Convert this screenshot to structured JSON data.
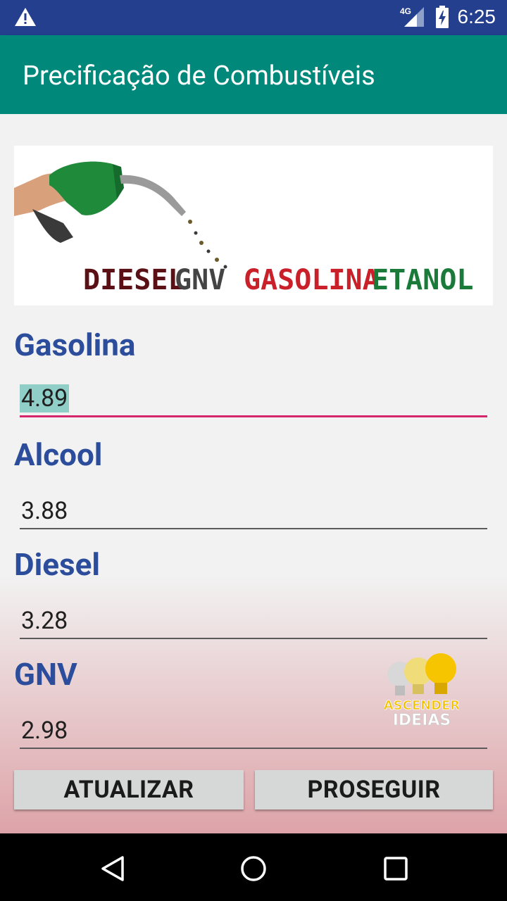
{
  "status_bar": {
    "time": "6:25",
    "network": "4G",
    "icons": [
      "warning-icon",
      "signal-icon",
      "battery-charging-icon"
    ]
  },
  "app_bar": {
    "title": "Precificação de Combustíveis"
  },
  "banner": {
    "words": [
      "DIESEL",
      "GNV",
      "GASOLINA",
      "ETANOL"
    ]
  },
  "fields": [
    {
      "label": "Gasolina",
      "value": "4.89",
      "focused": true
    },
    {
      "label": "Alcool",
      "value": "3.88",
      "focused": false
    },
    {
      "label": "Diesel",
      "value": "3.28",
      "focused": false
    },
    {
      "label": "GNV",
      "value": "2.98",
      "focused": false
    }
  ],
  "logo": {
    "line1": "ASCENDER",
    "line2": "IDEIAS"
  },
  "buttons": {
    "update": "ATUALIZAR",
    "proceed": "PROSEGUIR"
  },
  "nav_bar": {
    "icons": [
      "back-icon",
      "home-icon",
      "recents-icon"
    ]
  },
  "colors": {
    "status_bar": "#233f8e",
    "app_bar": "#00897b",
    "label": "#2c4d9b",
    "focus_underline": "#d6266b"
  }
}
